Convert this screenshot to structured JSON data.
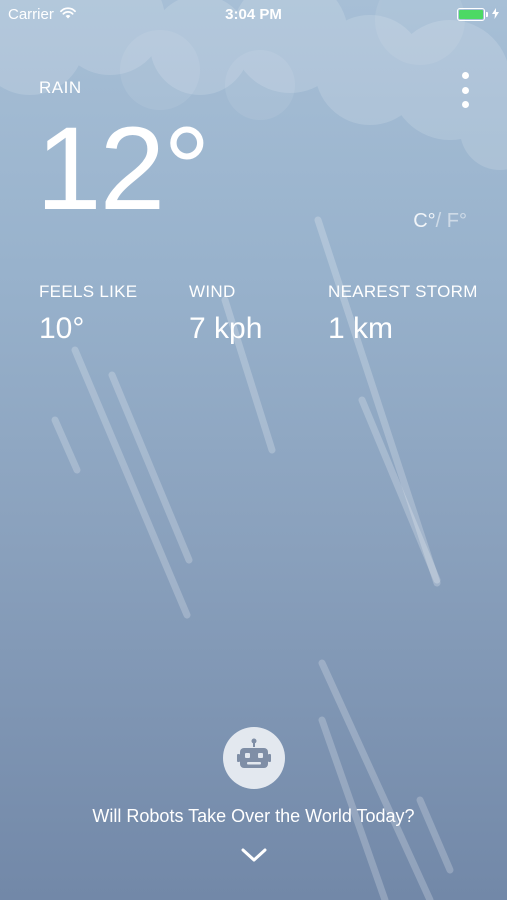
{
  "status_bar": {
    "carrier": "Carrier",
    "time": "3:04 PM",
    "battery_level": 1.0,
    "battery_color": "#4cd964"
  },
  "weather": {
    "condition": "RAIN",
    "temperature": "12°",
    "unit_celsius": "C°",
    "unit_separator": "/",
    "unit_fahrenheit": "F°"
  },
  "metrics": [
    {
      "label": "FEELS LIKE",
      "value": "10°"
    },
    {
      "label": "WIND",
      "value": "7 kph"
    },
    {
      "label": "NEAREST STORM",
      "value": "1 km"
    }
  ],
  "footer": {
    "question": "Will Robots Take Over the World Today?"
  },
  "icons": {
    "menu": "more-vertical-icon",
    "robot": "robot-icon",
    "expand": "chevron-down-icon",
    "wifi": "wifi-icon",
    "battery": "battery-icon",
    "charging": "bolt-icon"
  },
  "theme": {
    "accent": "#ffffff",
    "background_top": "#a7bfd6",
    "background_bottom": "#7288a8"
  }
}
